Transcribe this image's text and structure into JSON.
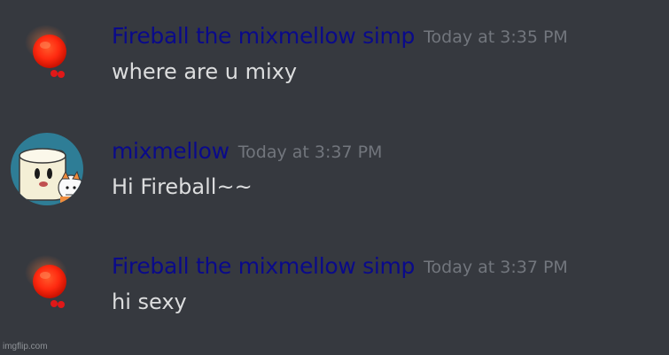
{
  "messages": [
    {
      "username": "Fireball the mixmellow simp",
      "timestamp": "Today at 3:35 PM",
      "text": "where are u mixy",
      "avatar_icon": "fireball-avatar-icon"
    },
    {
      "username": "mixmellow",
      "timestamp": "Today at 3:37 PM",
      "text": "Hi Fireball~~",
      "avatar_icon": "marshmallow-avatar-icon"
    },
    {
      "username": "Fireball the mixmellow simp",
      "timestamp": "Today at 3:37 PM",
      "text": "hi sexy",
      "avatar_icon": "fireball-avatar-icon"
    }
  ],
  "watermark": "imgflip.com",
  "colors": {
    "background": "#36393f",
    "username": "#0a0a8a",
    "timestamp": "#72767d",
    "message_text": "#dcddde"
  }
}
